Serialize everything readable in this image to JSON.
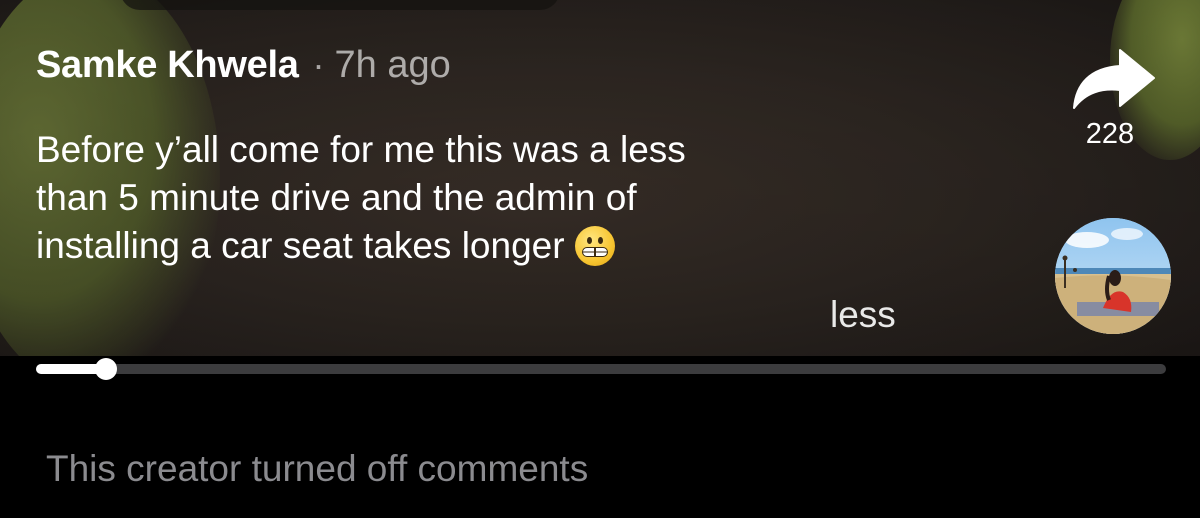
{
  "post": {
    "author": "Samke Khwela",
    "separator": "·",
    "time_ago": "7h ago",
    "caption_lines": [
      "Before y’all come for me this was a less",
      "than 5 minute drive and the admin of",
      "installing a car seat takes longer"
    ],
    "caption_emoji": "grimacing-face",
    "less_label": "less"
  },
  "actions": {
    "share_icon": "share-arrow-icon",
    "share_count": "228",
    "avatar_icon": "creator-avatar-beach"
  },
  "player": {
    "progress_fraction": 0.062
  },
  "comments": {
    "status_text": "This creator turned off comments"
  },
  "colors": {
    "background": "#000000",
    "progress_track": "#3c3c3e",
    "progress_fill": "#ffffff",
    "muted_text": "#8b8b8f"
  }
}
